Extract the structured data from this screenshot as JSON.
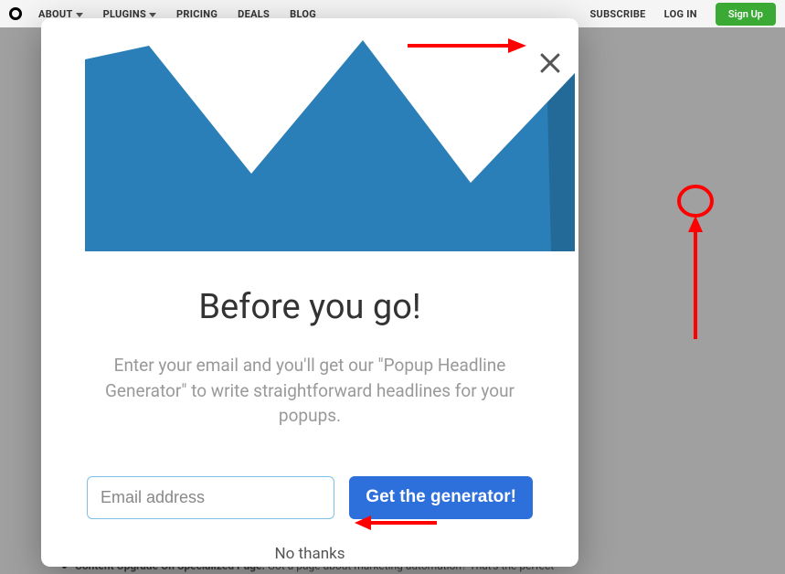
{
  "nav": {
    "items": [
      {
        "label": "ABOUT",
        "dropdown": true
      },
      {
        "label": "PLUGINS",
        "dropdown": true
      },
      {
        "label": "PRICING",
        "dropdown": false
      },
      {
        "label": "DEALS",
        "dropdown": false
      },
      {
        "label": "BLOG",
        "dropdown": false
      }
    ],
    "subscribe": "SUBSCRIBE",
    "login": "LOG IN",
    "signup": "Sign Up"
  },
  "modal": {
    "title": "Before you go!",
    "description": "Enter your email and you'll get our \"Popup Headline Generator\" to write straightforward headlines for your popups.",
    "email_placeholder": "Email address",
    "cta": "Get the generator!",
    "dismiss": "No thanks"
  },
  "background": {
    "bullet_bold": "Content Upgrade On Specialized Page:",
    "bullet_rest": " Got a page about marketing automation? That's the perfect"
  }
}
